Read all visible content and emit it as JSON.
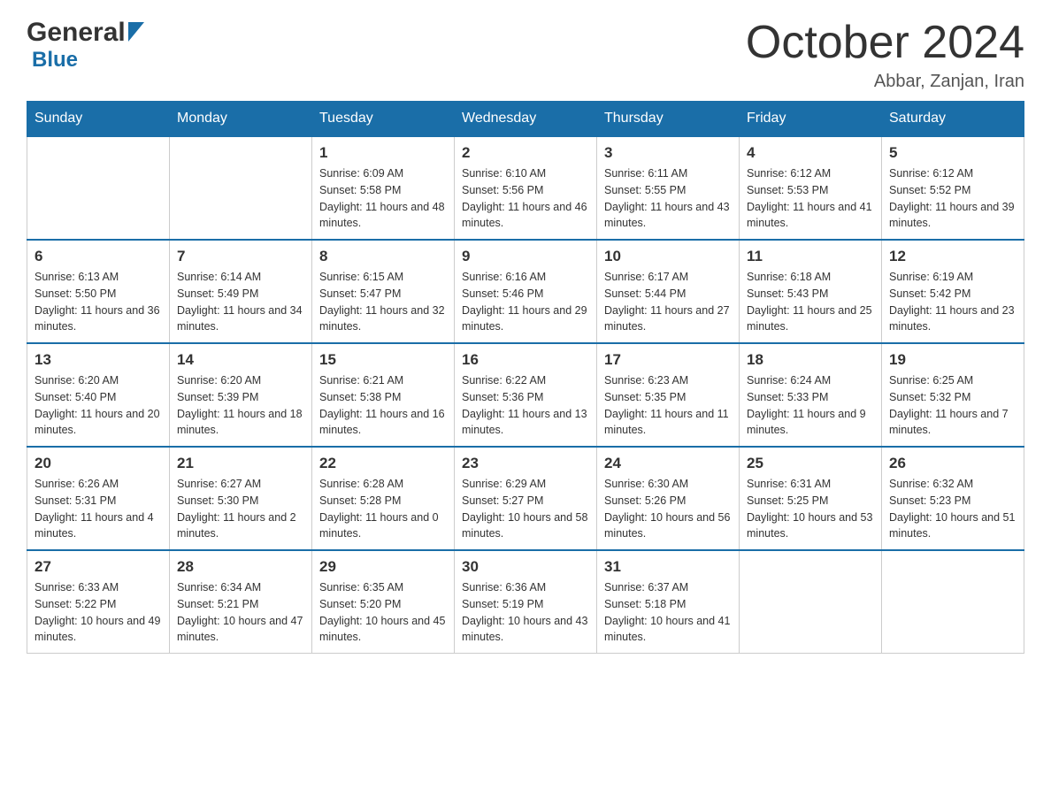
{
  "header": {
    "title": "October 2024",
    "subtitle": "Abbar, Zanjan, Iran",
    "logo_general": "General",
    "logo_blue": "Blue"
  },
  "weekdays": [
    "Sunday",
    "Monday",
    "Tuesday",
    "Wednesday",
    "Thursday",
    "Friday",
    "Saturday"
  ],
  "weeks": [
    [
      {
        "day": "",
        "sunrise": "",
        "sunset": "",
        "daylight": ""
      },
      {
        "day": "",
        "sunrise": "",
        "sunset": "",
        "daylight": ""
      },
      {
        "day": "1",
        "sunrise": "Sunrise: 6:09 AM",
        "sunset": "Sunset: 5:58 PM",
        "daylight": "Daylight: 11 hours and 48 minutes."
      },
      {
        "day": "2",
        "sunrise": "Sunrise: 6:10 AM",
        "sunset": "Sunset: 5:56 PM",
        "daylight": "Daylight: 11 hours and 46 minutes."
      },
      {
        "day": "3",
        "sunrise": "Sunrise: 6:11 AM",
        "sunset": "Sunset: 5:55 PM",
        "daylight": "Daylight: 11 hours and 43 minutes."
      },
      {
        "day": "4",
        "sunrise": "Sunrise: 6:12 AM",
        "sunset": "Sunset: 5:53 PM",
        "daylight": "Daylight: 11 hours and 41 minutes."
      },
      {
        "day": "5",
        "sunrise": "Sunrise: 6:12 AM",
        "sunset": "Sunset: 5:52 PM",
        "daylight": "Daylight: 11 hours and 39 minutes."
      }
    ],
    [
      {
        "day": "6",
        "sunrise": "Sunrise: 6:13 AM",
        "sunset": "Sunset: 5:50 PM",
        "daylight": "Daylight: 11 hours and 36 minutes."
      },
      {
        "day": "7",
        "sunrise": "Sunrise: 6:14 AM",
        "sunset": "Sunset: 5:49 PM",
        "daylight": "Daylight: 11 hours and 34 minutes."
      },
      {
        "day": "8",
        "sunrise": "Sunrise: 6:15 AM",
        "sunset": "Sunset: 5:47 PM",
        "daylight": "Daylight: 11 hours and 32 minutes."
      },
      {
        "day": "9",
        "sunrise": "Sunrise: 6:16 AM",
        "sunset": "Sunset: 5:46 PM",
        "daylight": "Daylight: 11 hours and 29 minutes."
      },
      {
        "day": "10",
        "sunrise": "Sunrise: 6:17 AM",
        "sunset": "Sunset: 5:44 PM",
        "daylight": "Daylight: 11 hours and 27 minutes."
      },
      {
        "day": "11",
        "sunrise": "Sunrise: 6:18 AM",
        "sunset": "Sunset: 5:43 PM",
        "daylight": "Daylight: 11 hours and 25 minutes."
      },
      {
        "day": "12",
        "sunrise": "Sunrise: 6:19 AM",
        "sunset": "Sunset: 5:42 PM",
        "daylight": "Daylight: 11 hours and 23 minutes."
      }
    ],
    [
      {
        "day": "13",
        "sunrise": "Sunrise: 6:20 AM",
        "sunset": "Sunset: 5:40 PM",
        "daylight": "Daylight: 11 hours and 20 minutes."
      },
      {
        "day": "14",
        "sunrise": "Sunrise: 6:20 AM",
        "sunset": "Sunset: 5:39 PM",
        "daylight": "Daylight: 11 hours and 18 minutes."
      },
      {
        "day": "15",
        "sunrise": "Sunrise: 6:21 AM",
        "sunset": "Sunset: 5:38 PM",
        "daylight": "Daylight: 11 hours and 16 minutes."
      },
      {
        "day": "16",
        "sunrise": "Sunrise: 6:22 AM",
        "sunset": "Sunset: 5:36 PM",
        "daylight": "Daylight: 11 hours and 13 minutes."
      },
      {
        "day": "17",
        "sunrise": "Sunrise: 6:23 AM",
        "sunset": "Sunset: 5:35 PM",
        "daylight": "Daylight: 11 hours and 11 minutes."
      },
      {
        "day": "18",
        "sunrise": "Sunrise: 6:24 AM",
        "sunset": "Sunset: 5:33 PM",
        "daylight": "Daylight: 11 hours and 9 minutes."
      },
      {
        "day": "19",
        "sunrise": "Sunrise: 6:25 AM",
        "sunset": "Sunset: 5:32 PM",
        "daylight": "Daylight: 11 hours and 7 minutes."
      }
    ],
    [
      {
        "day": "20",
        "sunrise": "Sunrise: 6:26 AM",
        "sunset": "Sunset: 5:31 PM",
        "daylight": "Daylight: 11 hours and 4 minutes."
      },
      {
        "day": "21",
        "sunrise": "Sunrise: 6:27 AM",
        "sunset": "Sunset: 5:30 PM",
        "daylight": "Daylight: 11 hours and 2 minutes."
      },
      {
        "day": "22",
        "sunrise": "Sunrise: 6:28 AM",
        "sunset": "Sunset: 5:28 PM",
        "daylight": "Daylight: 11 hours and 0 minutes."
      },
      {
        "day": "23",
        "sunrise": "Sunrise: 6:29 AM",
        "sunset": "Sunset: 5:27 PM",
        "daylight": "Daylight: 10 hours and 58 minutes."
      },
      {
        "day": "24",
        "sunrise": "Sunrise: 6:30 AM",
        "sunset": "Sunset: 5:26 PM",
        "daylight": "Daylight: 10 hours and 56 minutes."
      },
      {
        "day": "25",
        "sunrise": "Sunrise: 6:31 AM",
        "sunset": "Sunset: 5:25 PM",
        "daylight": "Daylight: 10 hours and 53 minutes."
      },
      {
        "day": "26",
        "sunrise": "Sunrise: 6:32 AM",
        "sunset": "Sunset: 5:23 PM",
        "daylight": "Daylight: 10 hours and 51 minutes."
      }
    ],
    [
      {
        "day": "27",
        "sunrise": "Sunrise: 6:33 AM",
        "sunset": "Sunset: 5:22 PM",
        "daylight": "Daylight: 10 hours and 49 minutes."
      },
      {
        "day": "28",
        "sunrise": "Sunrise: 6:34 AM",
        "sunset": "Sunset: 5:21 PM",
        "daylight": "Daylight: 10 hours and 47 minutes."
      },
      {
        "day": "29",
        "sunrise": "Sunrise: 6:35 AM",
        "sunset": "Sunset: 5:20 PM",
        "daylight": "Daylight: 10 hours and 45 minutes."
      },
      {
        "day": "30",
        "sunrise": "Sunrise: 6:36 AM",
        "sunset": "Sunset: 5:19 PM",
        "daylight": "Daylight: 10 hours and 43 minutes."
      },
      {
        "day": "31",
        "sunrise": "Sunrise: 6:37 AM",
        "sunset": "Sunset: 5:18 PM",
        "daylight": "Daylight: 10 hours and 41 minutes."
      },
      {
        "day": "",
        "sunrise": "",
        "sunset": "",
        "daylight": ""
      },
      {
        "day": "",
        "sunrise": "",
        "sunset": "",
        "daylight": ""
      }
    ]
  ]
}
